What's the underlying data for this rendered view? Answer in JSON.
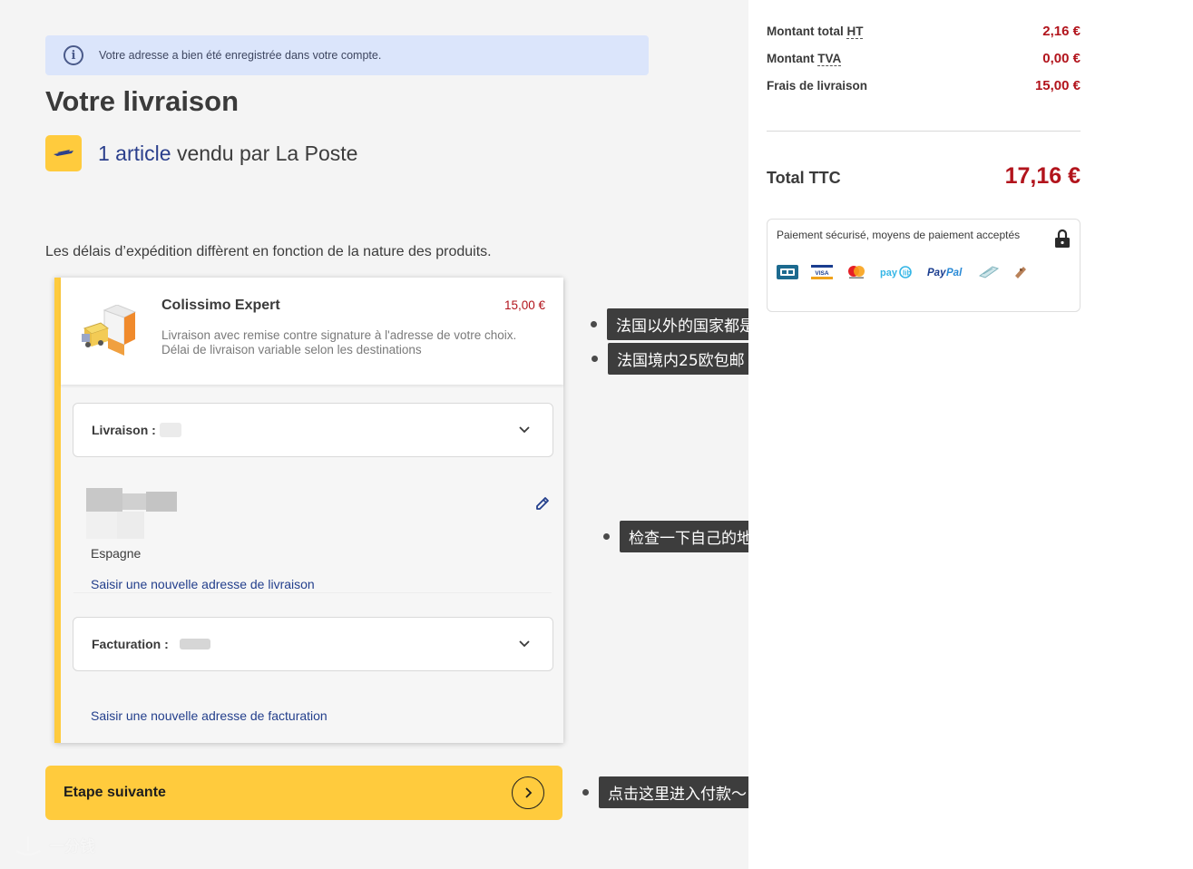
{
  "banner": {
    "icon": "info-icon",
    "text": "Votre adresse a bien été enregistrée dans votre compte."
  },
  "page": {
    "title": "Votre livraison"
  },
  "seller": {
    "count": "1 article",
    "sold_by": "vendu par La Poste",
    "logo": "la-poste-logo"
  },
  "delay_notice": "Les délais d’expédition diffèrent en fonction de la nature des produits.",
  "carrier": {
    "name": "Colissimo Expert",
    "price": "15,00 €",
    "desc_line1": "Livraison avec remise contre signature à l'adresse de votre choix.",
    "desc_line2": "Délai de livraison variable selon les destinations"
  },
  "delivery": {
    "label": "Livraison :",
    "country": "Espagne",
    "new_address_link": "Saisir une nouvelle adresse de livraison"
  },
  "billing": {
    "label": "Facturation :",
    "new_address_link": "Saisir une nouvelle adresse de facturation"
  },
  "next_button": {
    "label": "Etape suivante"
  },
  "watermark": "一分钱",
  "annotations": {
    "a1": "法国以外的国家都是colissimo快递送货",
    "a2": "法国境内25欧包邮",
    "a3": "检查一下自己的地址是否正确",
    "a4": "点击这里进入付款～"
  },
  "summary": {
    "rows": [
      {
        "label_prefix": "Montant total ",
        "abbr": "HT",
        "value": "2,16 €"
      },
      {
        "label_prefix": "Montant ",
        "abbr": "TVA",
        "value": "0,00 €"
      },
      {
        "label_prefix": "Frais de livraison",
        "abbr": "",
        "value": "15,00 €"
      }
    ],
    "total_label": "Total TTC",
    "total_value": "17,16 €"
  },
  "payment": {
    "title": "Paiement sécurisé, moyens de paiement acceptés",
    "logos": [
      "cb",
      "visa",
      "mastercard",
      "paylib",
      "PayPal",
      "cheque",
      "gift-card"
    ],
    "colors": {
      "accent_yellow": "#ffcb3d",
      "price_red": "#b2141c",
      "link_blue": "#233f8c"
    }
  }
}
